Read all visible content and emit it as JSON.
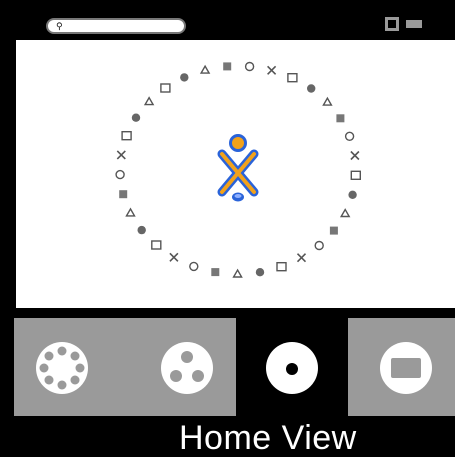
{
  "topbar": {
    "search_value": "",
    "icons": [
      "search-icon",
      "frame-icon",
      "battery-icon"
    ]
  },
  "home_view": {
    "center_icon": "xo-person-icon",
    "ring_icons": [
      "activity-icon-01",
      "activity-icon-02",
      "activity-icon-03",
      "activity-icon-04",
      "activity-icon-05",
      "activity-icon-06",
      "activity-icon-07",
      "activity-icon-08",
      "activity-icon-09",
      "activity-icon-10",
      "activity-icon-11",
      "activity-icon-12",
      "activity-icon-13",
      "activity-icon-14",
      "activity-icon-15",
      "activity-icon-16",
      "activity-icon-17",
      "activity-icon-18",
      "activity-icon-19",
      "activity-icon-20",
      "activity-icon-21",
      "activity-icon-22",
      "activity-icon-23",
      "activity-icon-24",
      "activity-icon-25",
      "activity-icon-26",
      "activity-icon-27",
      "activity-icon-28",
      "activity-icon-29",
      "activity-icon-30",
      "activity-icon-31",
      "activity-icon-32",
      "activity-icon-33"
    ]
  },
  "modes": {
    "items": [
      {
        "name": "neighborhood-view-button",
        "icon": "neighborhood-icon",
        "selected": false
      },
      {
        "name": "group-view-button",
        "icon": "group-icon",
        "selected": false
      },
      {
        "name": "home-view-button",
        "icon": "home-icon",
        "selected": true
      },
      {
        "name": "activity-view-button",
        "icon": "activity-icon",
        "selected": false
      }
    ],
    "current_label": "Home View"
  },
  "colors": {
    "background": "#000000",
    "panel": "#ffffff",
    "tile": "#9a9a9a",
    "xo_stroke": "#2a63d9",
    "xo_fill": "#f2a21b"
  }
}
